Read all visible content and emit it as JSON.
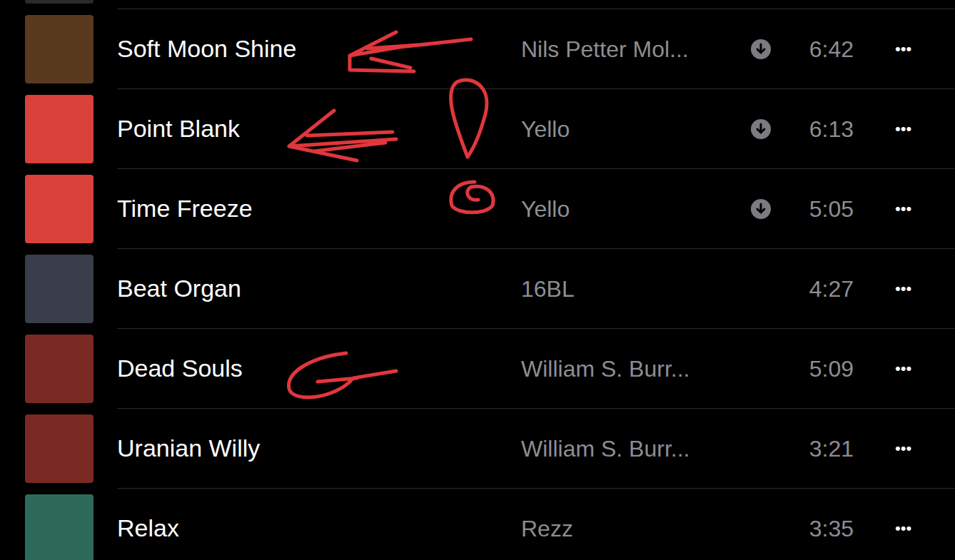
{
  "tracks": [
    {
      "title": "Soft Moon Shine",
      "artist": "Nils Petter Mol...",
      "duration": "6:42",
      "downloaded": true,
      "more": "•••",
      "color": "#5a3a1e"
    },
    {
      "title": "Point Blank",
      "artist": "Yello",
      "duration": "6:13",
      "downloaded": true,
      "more": "•••",
      "color": "#d8423a"
    },
    {
      "title": "Time Freeze",
      "artist": "Yello",
      "duration": "5:05",
      "downloaded": true,
      "more": "•••",
      "color": "#d8423a"
    },
    {
      "title": "Beat Organ",
      "artist": "16BL",
      "duration": "4:27",
      "downloaded": false,
      "more": "•••",
      "color": "#3a3d4a"
    },
    {
      "title": "Dead Souls",
      "artist": "William S. Burr...",
      "duration": "5:09",
      "downloaded": false,
      "more": "•••",
      "color": "#7a2a22"
    },
    {
      "title": "Uranian Willy",
      "artist": "William S. Burr...",
      "duration": "3:21",
      "downloaded": false,
      "more": "•••",
      "color": "#7a2a22"
    },
    {
      "title": "Relax",
      "artist": "Rezz",
      "duration": "3:35",
      "downloaded": false,
      "more": "•••",
      "color": "#2d6a5a"
    }
  ]
}
